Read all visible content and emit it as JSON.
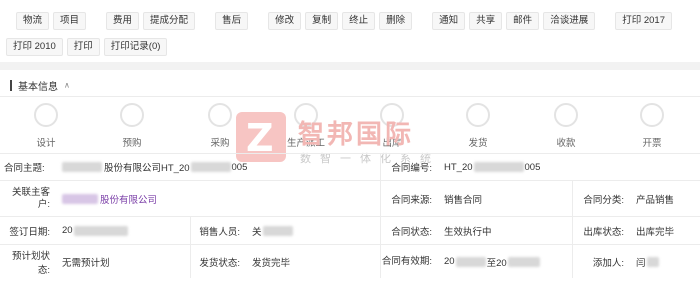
{
  "toolbar": {
    "row1": [
      {
        "group": "",
        "buttons": [
          "物流",
          "项目"
        ]
      },
      {
        "group": "",
        "buttons": [
          "费用",
          "提成分配"
        ]
      },
      {
        "group": "",
        "buttons": [
          "售后"
        ]
      },
      {
        "group": "",
        "buttons": [
          "修改",
          "复制",
          "终止",
          "删除"
        ]
      },
      {
        "group": "",
        "buttons": [
          "通知",
          "共享",
          "邮件",
          "洽谈进展"
        ]
      },
      {
        "group": "",
        "buttons": [
          "打印 2017"
        ]
      }
    ],
    "row2": [
      "打印 2010",
      "打印",
      "打印记录(0)"
    ]
  },
  "section": {
    "title": "基本信息"
  },
  "steps": [
    "设计",
    "预购",
    "采购",
    "生产派工",
    "出库",
    "发货",
    "收款",
    "开票"
  ],
  "watermark": {
    "name": "智邦国际",
    "tagline": "数智一体化系统"
  },
  "fields": {
    "contract_subject_label": "合同主题:",
    "contract_subject_mid": "股份有限公司HT_20",
    "contract_subject_end": "005",
    "contract_no_label": "合同编号:",
    "contract_no_start": "HT_20",
    "contract_no_end": "005",
    "customer_label": "关联主客户:",
    "customer_value": "股份有限公司",
    "source_label": "合同来源:",
    "source_value": "销售合同",
    "category_label": "合同分类:",
    "category_value": "产品销售",
    "sign_date_label": "签订日期:",
    "sign_date_value": "20",
    "salesperson_label": "销售人员:",
    "salesperson_value": "关",
    "status_label": "合同状态:",
    "status_value": "生效执行中",
    "outbound_label": "出库状态:",
    "outbound_value": "出库完毕",
    "plan_label": "预计划状态:",
    "plan_value": "无需预计划",
    "ship_label": "发货状态:",
    "ship_value": "发货完毕",
    "validity_label": "合同有效期:",
    "validity_start": "20",
    "validity_mid": "至20",
    "adder_label": "添加人:",
    "adder_value": "闫"
  }
}
